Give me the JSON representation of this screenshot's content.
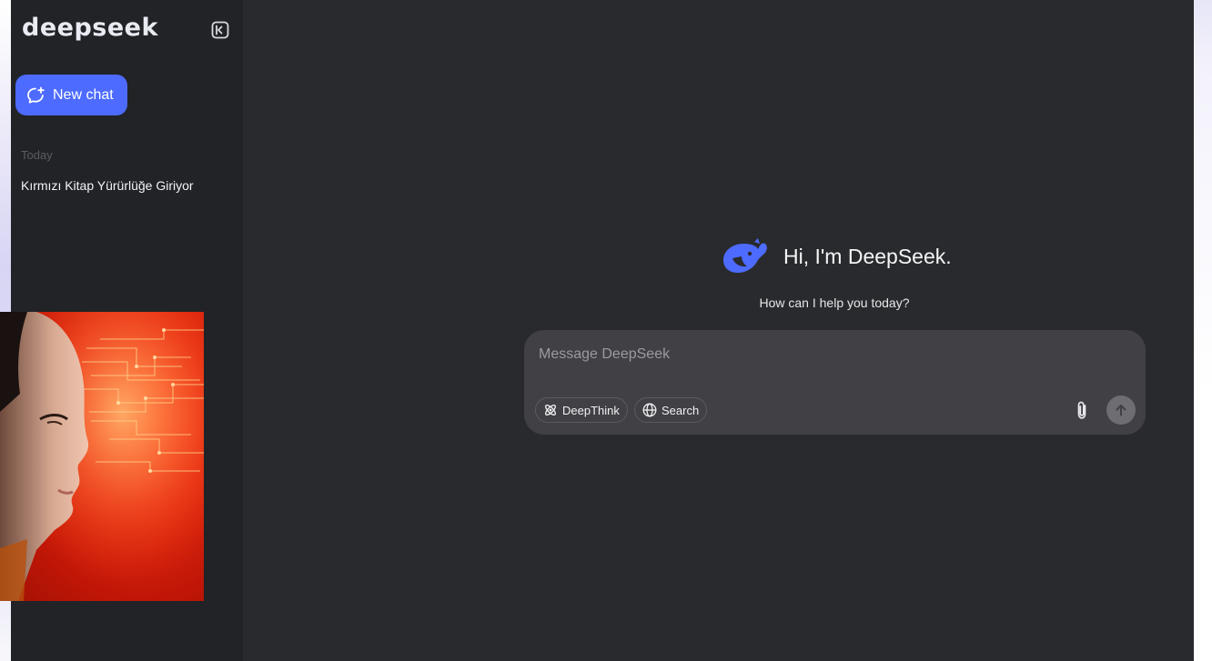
{
  "sidebar": {
    "logo": "deepseek",
    "new_chat_label": "New chat",
    "section_label": "Today",
    "history": [
      "Kırmızı Kitap Yürürlüğe Giriyor"
    ]
  },
  "main": {
    "greeting": "Hi, I'm DeepSeek.",
    "subtitle": "How can I help you today?",
    "composer": {
      "placeholder": "Message DeepSeek",
      "value": "",
      "deepthink_label": "DeepThink",
      "search_label": "Search"
    }
  },
  "colors": {
    "accent": "#4d6bfe",
    "sidebar_bg": "#212327",
    "main_bg": "#292a2d",
    "composer_bg": "#404045"
  },
  "icons": {
    "collapse": "sidebar-collapse-icon",
    "new_chat": "chat-plus-icon",
    "logo_mark": "whale-icon",
    "deepthink": "atom-icon",
    "search": "globe-icon",
    "attach": "paperclip-icon",
    "send": "arrow-up-icon"
  },
  "overlay_image": "portrait-red-circuit-image"
}
